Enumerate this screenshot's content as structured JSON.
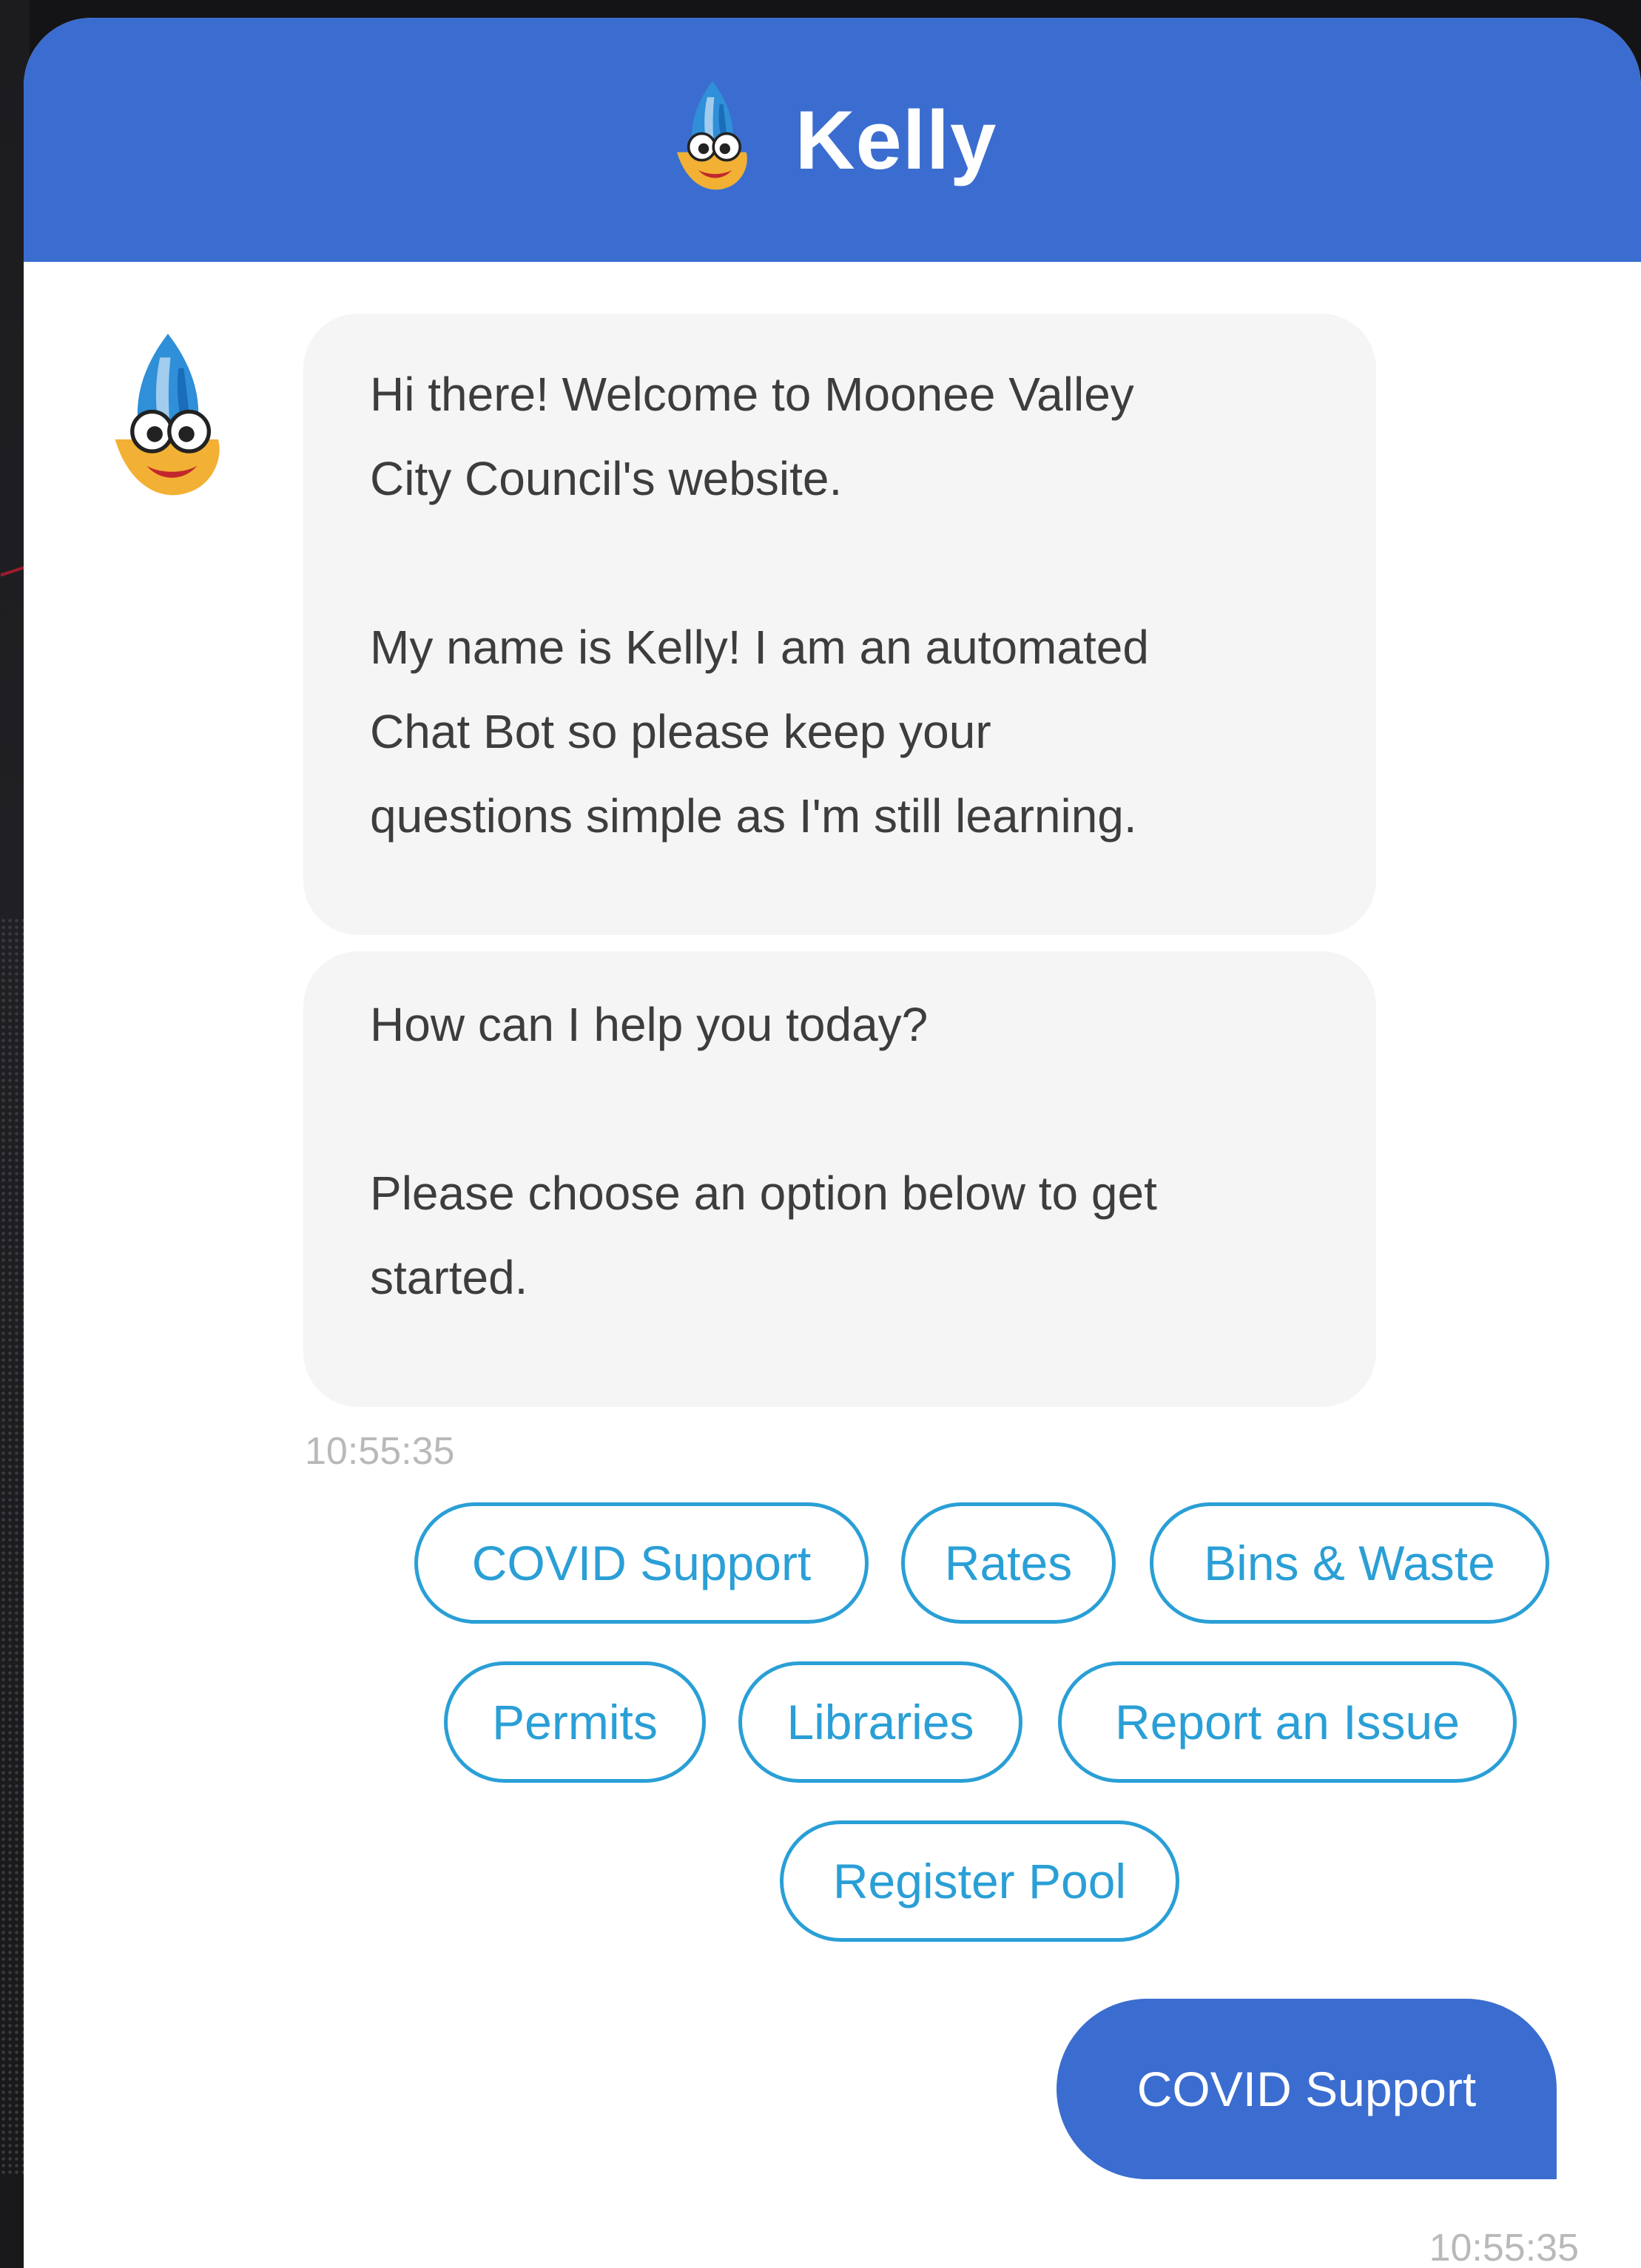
{
  "header": {
    "title": "Kelly"
  },
  "messages": {
    "welcome": "Hi there! Welcome to Moonee Valley\nCity Council's website.",
    "intro": "My name is Kelly! I am an automated\nChat Bot so please keep your\nquestions simple as I'm still learning.",
    "help": "How can I help you today?",
    "choose": "Please choose an option below to get\nstarted.",
    "bot_time": "10:55:35"
  },
  "quick_replies": [
    {
      "label": "COVID Support"
    },
    {
      "label": "Rates"
    },
    {
      "label": "Bins & Waste"
    },
    {
      "label": "Permits"
    },
    {
      "label": "Libraries"
    },
    {
      "label": "Report an Issue"
    },
    {
      "label": "Register Pool"
    }
  ],
  "user_message": {
    "text": "COVID Support",
    "time": "10:55:35"
  },
  "colors": {
    "header_blue": "#3b6dd0",
    "chip_blue": "#2a9fd6",
    "bubble_grey": "#f5f5f5",
    "text_dark": "#3d3d3d",
    "timestamp_grey": "#b9b9b9"
  },
  "icons": {
    "avatar": "kelly-mascot-icon"
  }
}
